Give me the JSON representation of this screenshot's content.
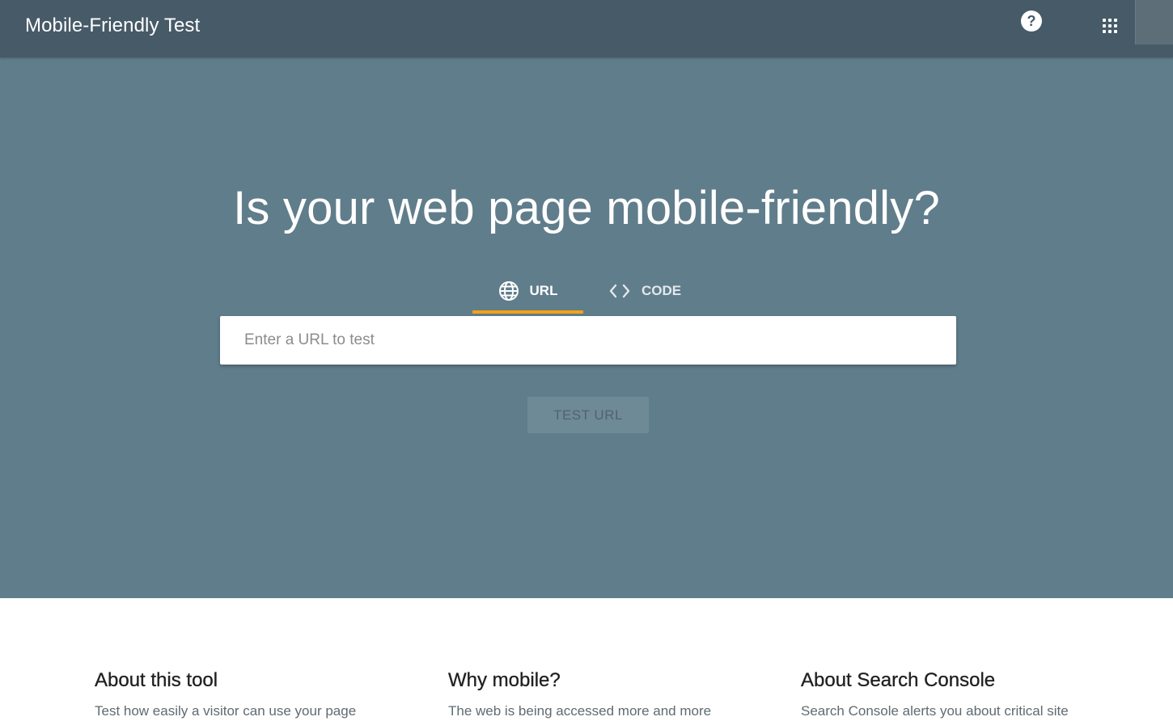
{
  "header": {
    "title": "Mobile-Friendly Test",
    "help_icon": "help-circle-icon",
    "apps_icon": "apps-grid-icon"
  },
  "hero": {
    "title": "Is your web page mobile-friendly?",
    "tabs": [
      {
        "label": "URL",
        "icon": "globe-icon",
        "selected": true
      },
      {
        "label": "CODE",
        "icon": "code-brackets-icon",
        "selected": false
      }
    ],
    "url_input": {
      "placeholder": "Enter a URL to test",
      "value": ""
    },
    "test_button": "TEST URL"
  },
  "info": {
    "columns": [
      {
        "title": "About this tool",
        "text": "Test how easily a visitor can use your page"
      },
      {
        "title": "Why mobile?",
        "text": "The web is being accessed more and more"
      },
      {
        "title": "About Search Console",
        "text": "Search Console alerts you about critical site"
      }
    ]
  },
  "colors": {
    "header_bg": "#475a68",
    "hero_bg": "#607d8b",
    "tab_accent": "#f4a118"
  }
}
